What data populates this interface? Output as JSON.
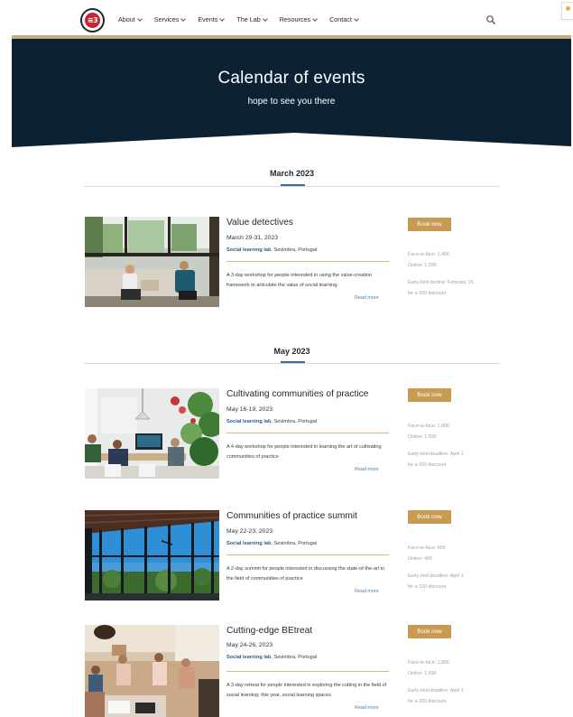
{
  "nav": {
    "items": [
      {
        "label": "About"
      },
      {
        "label": "Services"
      },
      {
        "label": "Events"
      },
      {
        "label": "The Lab"
      },
      {
        "label": "Resources"
      },
      {
        "label": "Contact"
      }
    ]
  },
  "hero": {
    "title": "Calendar of events",
    "subtitle": "hope to see you there"
  },
  "months": [
    {
      "label": "March 2023"
    },
    {
      "label": "May 2023"
    }
  ],
  "events": [
    {
      "title": "Value detectives",
      "date": "March 29-31, 2023",
      "location_link": "Social learning lab",
      "location_rest": ", Sesimbra, Portugal",
      "description": "A 3-day workshop for people interested in using the value-creation framework to articulate the value of social learning.",
      "read_more": "Read more",
      "book_label": "Book now",
      "price_face": "Face-to-face: 1,400",
      "price_online": "Online: 1,200",
      "early_line1": "Early-bird decline: February 15",
      "early_line2": "for a 200 discount"
    },
    {
      "title": "Cultivating communities of practice",
      "date": "May 16-19, 2023",
      "location_link": "Social learning lab",
      "location_rest": ", Sesimbra, Portugal",
      "description": "A 4-day workshop for people interested in learning the art of cultivating communities of practice",
      "read_more": "Read more",
      "book_label": "Book now",
      "price_face": "Face-to-face: 1,800",
      "price_online": "Online: 1,500",
      "early_line1": "Early-bird deadline: April 1",
      "early_line2": "for a 200 discount"
    },
    {
      "title": "Communities of practice summit",
      "date": "May 22-23, 2023",
      "location_link": "Social learning lab",
      "location_rest": ", Sesimbra, Portugal",
      "description": "A 2-day summit for people interested in discussing the state-of-the-art in the field of communities of practice",
      "read_more": "Read more",
      "book_label": "Book now",
      "price_face": "Face-to-face: 600",
      "price_online": "Online: 400",
      "early_line1": "Early-bird deadline: April 1",
      "early_line2": "for a 100 discount"
    },
    {
      "title": "Cutting-edge BEtreat",
      "date": "May 24-26, 2023",
      "location_link": "Social learning lab",
      "location_rest": ", Sesimbra, Portugal",
      "description": "A 3-day retreat for people interested in exploring the cutting in the field of social learning: this year, social learning spaces",
      "read_more": "Read more",
      "book_label": "Book now",
      "price_face": "Face-to-face: 1,800",
      "price_online": "Online: 1,500",
      "early_line1": "Early-bird deadline: April 1",
      "early_line2": "for a 200 discount"
    }
  ],
  "icons": {
    "search": "search-icon",
    "chevron": "chevron-down-icon",
    "logo": "logo-icon"
  },
  "colors": {
    "hero_bg": "#0c2233",
    "accent_gold": "#c99a51",
    "link_blue": "#2b5a8c"
  }
}
